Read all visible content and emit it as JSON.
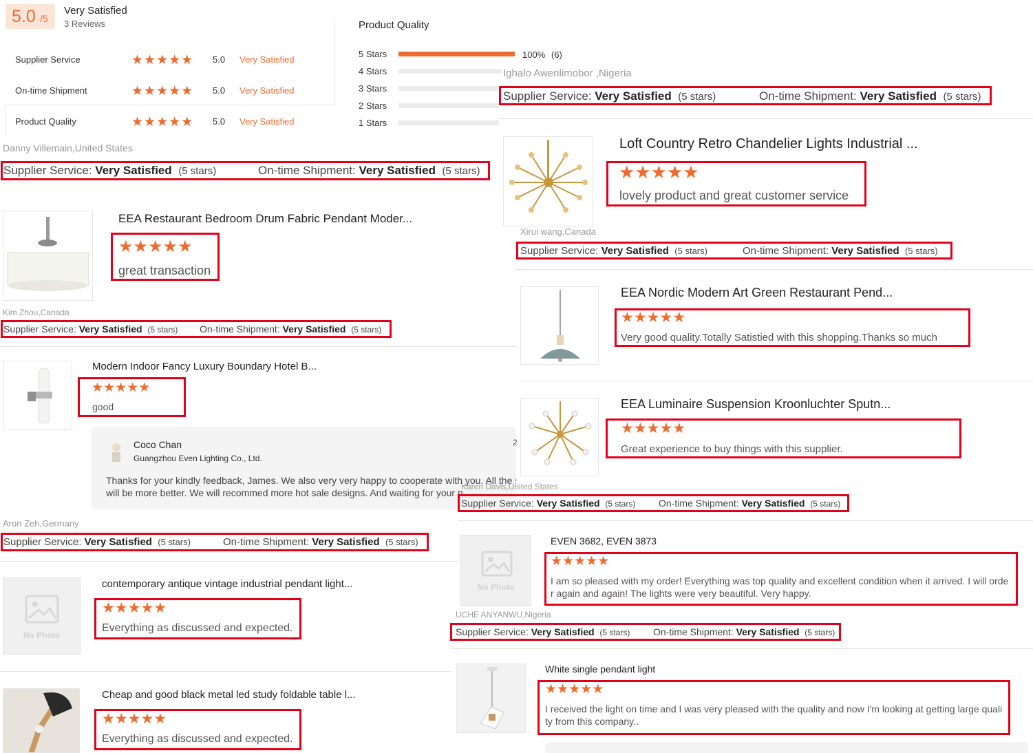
{
  "colors": {
    "accent": "#ee6b2f",
    "highlight_box": "#e3001b",
    "score_bg": "#fbe5d7"
  },
  "summary": {
    "score": "5.0",
    "score_suffix": "/5",
    "label": "Very Satisfied",
    "reviews": "3 Reviews",
    "rows": [
      {
        "name": "Supplier Service",
        "stars": 5,
        "value": "5.0",
        "verdict": "Very Satisfied"
      },
      {
        "name": "On-time Shipment",
        "stars": 5,
        "value": "5.0",
        "verdict": "Very Satisfied"
      },
      {
        "name": "Product Quality",
        "stars": 5,
        "value": "5.0",
        "verdict": "Very Satisfied"
      }
    ]
  },
  "quality": {
    "title": "Product Quality",
    "rows": [
      {
        "label": "5 Stars",
        "fraction": 1.0,
        "percent": "100%",
        "count": "(6)"
      },
      {
        "label": "4 Stars",
        "fraction": 0
      },
      {
        "label": "3 Stars",
        "fraction": 0
      },
      {
        "label": "2 Stars",
        "fraction": 0
      },
      {
        "label": "1 Stars",
        "fraction": 0
      }
    ]
  },
  "labels": {
    "supplier_service": "Supplier Service:",
    "ontime_shipment": "On-time Shipment:",
    "very_satisfied": "Very Satisfied",
    "five_stars": "(5 stars)",
    "star_glyph": "★",
    "no_photo": "No Photo"
  },
  "left": {
    "r1": {
      "reviewer": "Danny Villemain,United States",
      "title": "EEA Restaurant Bedroom Drum Fabric Pendant Moder...",
      "text": "great transaction",
      "stars": 5
    },
    "r2": {
      "reviewer": "Kim Zhou,Canada",
      "title": "Modern Indoor Fancy Luxury Boundary Hotel B...",
      "text": "good",
      "stars": 5
    },
    "reply": {
      "name": "Coco Chan",
      "company": "Guangzhou Even Lighting Co., Ltd.",
      "line1": "Thanks for your kindly feedback, James. We also very very happy to cooperate with you. All the se",
      "line2": "will be more better. We will recommed more hot sale designs. And waiting for your n",
      "side_char": "2"
    },
    "r3": {
      "reviewer": "Aron Zeh,Germany",
      "title": "contemporary antique vintage industrial pendant light...",
      "text": "Everything as discussed and expected.",
      "stars": 5
    },
    "r4": {
      "title": "Cheap and good black metal led study foldable table l...",
      "text": "Everything as discussed and expected.",
      "stars": 5
    }
  },
  "right": {
    "r0": {
      "reviewer": "Ighalo Awenlimobor ,Nigeria"
    },
    "r1": {
      "title": "Loft Country Retro Chandelier Lights Industrial ...",
      "text": "lovely product and great customer service",
      "reviewer": "Xirui wang,Canada",
      "stars": 5
    },
    "r2": {
      "title": "EEA Nordic Modern Art Green Restaurant Pend...",
      "text": "Very good  quality.Totally Satistied with this shopping.Thanks so much",
      "stars": 5
    },
    "r3": {
      "title": "EEA Luminaire Suspension Kroonluchter Sputn...",
      "text": "Great experience to buy things with this supplier.",
      "reviewer": "Karen Davis,United States",
      "stars": 5
    },
    "r4": {
      "title": "EVEN 3682, EVEN 3873",
      "text1": "I am so pleased with my order! Everything was top quality and excellent condition when it arrived. I will orde",
      "text2": "r again and again! The lights were very beautiful. Very happy.",
      "reviewer": "UCHE ANYANWU,Nigeria",
      "stars": 5
    },
    "r5": {
      "title": "White single pendant light",
      "text1": "I received the light on time and I was very pleased with the quality and now I'm looking at getting large quali",
      "text2": "ty from this company..",
      "stars": 5
    }
  }
}
